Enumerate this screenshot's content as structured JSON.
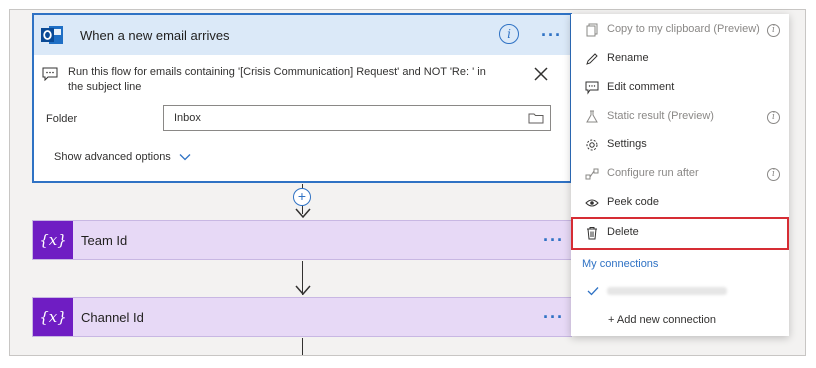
{
  "trigger": {
    "title": "When a new email arrives",
    "info_symbol": "i",
    "more_symbol": "···",
    "comment": "Run this flow for emails containing '[Crisis Communication] Request' and NOT 'Re: ' in the subject line",
    "folder_label": "Folder",
    "folder_value": "Inbox",
    "advanced_options": "Show advanced options"
  },
  "add_step_symbol": "+",
  "variables": [
    {
      "title": "Team Id",
      "icon_text": "{x}"
    },
    {
      "title": "Channel Id",
      "icon_text": "{x}"
    }
  ],
  "menu": {
    "items": [
      {
        "label": "Copy to my clipboard (Preview)",
        "icon": "copy-icon",
        "disabled": true,
        "info": true
      },
      {
        "label": "Rename",
        "icon": "pencil-icon",
        "disabled": false,
        "info": false
      },
      {
        "label": "Edit comment",
        "icon": "comment-icon",
        "disabled": false,
        "info": false
      },
      {
        "label": "Static result (Preview)",
        "icon": "flask-icon",
        "disabled": true,
        "info": true
      },
      {
        "label": "Settings",
        "icon": "gear-icon",
        "disabled": false,
        "info": false
      },
      {
        "label": "Configure run after",
        "icon": "flow-icon",
        "disabled": true,
        "info": true
      },
      {
        "label": "Peek code",
        "icon": "eye-icon",
        "disabled": false,
        "info": false
      },
      {
        "label": "Delete",
        "icon": "trash-icon",
        "disabled": false,
        "info": false
      }
    ],
    "connections_heading": "My connections",
    "add_connection": "+ Add new connection"
  },
  "colors": {
    "accent": "#2f72c4",
    "trigger_header": "#dbe9f8",
    "variable_card": "#e7d9f6",
    "variable_icon": "#6f1dc3",
    "delete_highlight": "#d62d34"
  }
}
